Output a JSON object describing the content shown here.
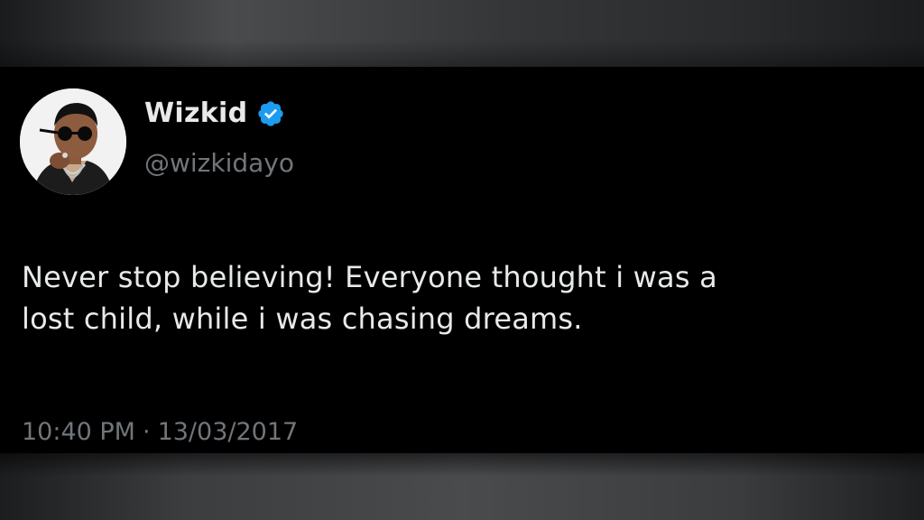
{
  "tweet": {
    "author": {
      "display_name": "Wizkid",
      "handle": "@wizkidayo",
      "verified": true
    },
    "text_lines": [
      "Never stop believing! Everyone thought i was a",
      "lost child, while i was chasing dreams."
    ],
    "time": "10:40 PM",
    "separator": "·",
    "date": "13/03/2017"
  },
  "colors": {
    "background": "#000000",
    "primary_text": "#e7e9ea",
    "secondary_text": "#71767b",
    "verified_badge": "#1d9bf0"
  },
  "icons": {
    "verified": "verified-badge-icon"
  }
}
